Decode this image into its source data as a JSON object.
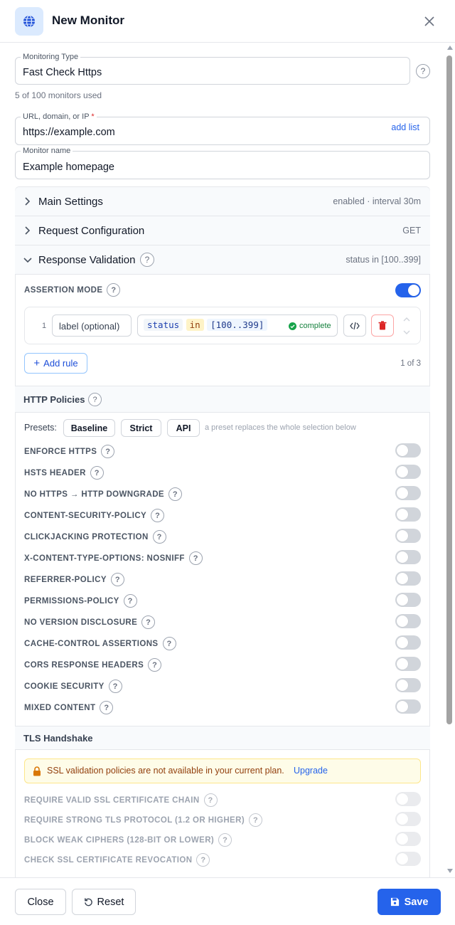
{
  "header": {
    "title": "New Monitor",
    "close_icon": "close-icon",
    "logo_icon": "globe-icon"
  },
  "monitoring_type": {
    "label": "Monitoring Type",
    "value": "Fast Check Https",
    "usage": "5 of 100 monitors used"
  },
  "url": {
    "label": "URL, domain, or IP",
    "required_mark": "*",
    "value": "https://example.com",
    "add_list": "add list"
  },
  "monitor_name": {
    "label": "Monitor name",
    "value": "Example homepage"
  },
  "main_settings": {
    "title": "Main Settings",
    "summary": "enabled · interval 30m",
    "expanded": false
  },
  "request_config": {
    "title": "Request Configuration",
    "summary": "GET",
    "expanded": false
  },
  "response_validation": {
    "title": "Response Validation",
    "summary": "status in [100..399]",
    "expanded": true,
    "assertion_mode_label": "ASSERTION MODE",
    "assertion_mode_on": true,
    "rule": {
      "index": "1",
      "label_placeholder": "label (optional)",
      "token_field": "status",
      "token_op": "in",
      "token_value": "[100..399]",
      "status": "complete"
    },
    "add_rule": "Add rule",
    "rule_count": "1 of 3"
  },
  "http_policies": {
    "title": "HTTP Policies",
    "presets_label": "Presets:",
    "presets": [
      "Baseline",
      "Strict",
      "API"
    ],
    "presets_note": "a preset replaces the whole selection below",
    "items": [
      {
        "label": "ENFORCE HTTPS",
        "on": false
      },
      {
        "label": "HSTS HEADER",
        "on": false
      },
      {
        "label": "NO HTTPS → HTTP DOWNGRADE",
        "on": false
      },
      {
        "label": "CONTENT-SECURITY-POLICY",
        "on": false
      },
      {
        "label": "CLICKJACKING PROTECTION",
        "on": false
      },
      {
        "label": "X-CONTENT-TYPE-OPTIONS: NOSNIFF",
        "on": false
      },
      {
        "label": "REFERRER-POLICY",
        "on": false
      },
      {
        "label": "PERMISSIONS-POLICY",
        "on": false
      },
      {
        "label": "NO VERSION DISCLOSURE",
        "on": false
      },
      {
        "label": "CACHE-CONTROL ASSERTIONS",
        "on": false
      },
      {
        "label": "CORS RESPONSE HEADERS",
        "on": false
      },
      {
        "label": "COOKIE SECURITY",
        "on": false
      },
      {
        "label": "MIXED CONTENT",
        "on": false
      }
    ]
  },
  "tls": {
    "title": "TLS Handshake",
    "warning": "SSL validation policies are not available in your current plan.",
    "upgrade": "Upgrade",
    "items": [
      {
        "label": "REQUIRE VALID SSL CERTIFICATE CHAIN",
        "on": false
      },
      {
        "label": "REQUIRE STRONG TLS PROTOCOL (1.2 OR HIGHER)",
        "on": false
      },
      {
        "label": "BLOCK WEAK CIPHERS (128-BIT OR LOWER)",
        "on": false
      },
      {
        "label": "CHECK SSL CERTIFICATE REVOCATION",
        "on": false
      }
    ]
  },
  "help_glyph": "?",
  "footer": {
    "close": "Close",
    "reset": "Reset",
    "save": "Save"
  },
  "colors": {
    "primary": "#2563eb",
    "danger": "#dc2626",
    "success": "#16a34a",
    "warning_bg": "#fefce8"
  }
}
